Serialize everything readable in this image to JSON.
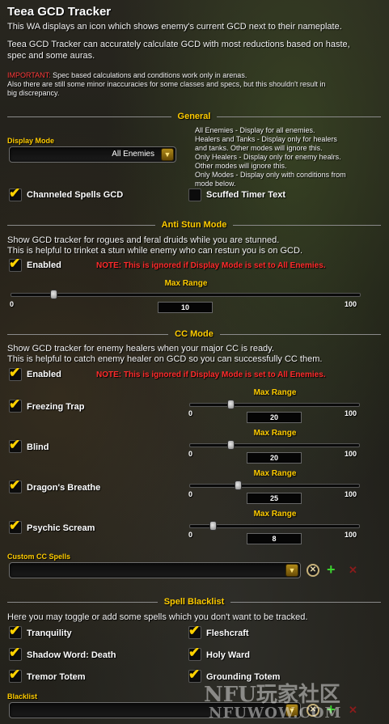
{
  "title": "Teea GCD Tracker",
  "intro": {
    "line1": "This WA displays an icon which shows enemy's current GCD next to their nameplate.",
    "line2": "Teea GCD Tracker can accurately calculate GCD with most reductions based on haste,",
    "line3": "spec and some auras.",
    "important_label": "IMPORTANT:",
    "important_text": " Spec based calculations and conditions work only in arenas.",
    "note_line2": "Also there are still some minor inaccuracies for some classes and specs, but this shouldn't result in",
    "note_line3": "big discrepancy."
  },
  "general": {
    "header": "General",
    "display_mode_label": "Display Mode",
    "display_mode_value": "All Enemies",
    "help": [
      "All Enemies - Display for all enemies.",
      "Healers and Tanks - Display only for healers",
      "and tanks. Other modes will ignore this.",
      "Only Healers - Display only for enemy healrs.",
      "Other modes will ignore this.",
      "Only Modes - Display only with conditions from",
      "mode below."
    ],
    "channeled_label": "Channeled Spells GCD",
    "scuffed_label": "Scuffed Timer Text"
  },
  "anti_stun": {
    "header": "Anti Stun Mode",
    "desc1": "Show GCD tracker for rogues and feral druids while you are stunned.",
    "desc2": "This is helpful to trinket a stun while enemy who can restun you is on GCD.",
    "enabled_label": "Enabled",
    "note": "NOTE: This is ignored if Display Mode is set to All Enemies.",
    "range_title": "Max Range",
    "min": "0",
    "max": "100",
    "value": "10"
  },
  "cc_mode": {
    "header": "CC Mode",
    "desc1": "Show GCD tracker for enemy healers when your major CC is ready.",
    "desc2": "This is helpful to catch enemy healer on GCD so you can successfully CC them.",
    "enabled_label": "Enabled",
    "note": "NOTE: This is ignored if Display Mode is set to All Enemies.",
    "spells": [
      {
        "label": "Freezing Trap",
        "range_title": "Max Range",
        "min": "0",
        "max": "100",
        "value": "20"
      },
      {
        "label": "Blind",
        "range_title": "Max Range",
        "min": "0",
        "max": "100",
        "value": "20"
      },
      {
        "label": "Dragon's Breathe",
        "range_title": "Max Range",
        "min": "0",
        "max": "100",
        "value": "25"
      },
      {
        "label": "Psychic Scream",
        "range_title": "Max Range",
        "min": "0",
        "max": "100",
        "value": "8"
      }
    ],
    "custom_label": "Custom CC Spells"
  },
  "blacklist": {
    "header": "Spell Blacklist",
    "desc": "Here you may toggle or add some spells which you don't want to be tracked.",
    "spells_left": [
      "Tranquility",
      "Shadow Word: Death",
      "Tremor Totem"
    ],
    "spells_right": [
      "Fleshcraft",
      "Holy Ward",
      "Grounding Totem"
    ],
    "list_label": "Blacklist"
  },
  "watermark": {
    "top": "NFU玩家社区",
    "bottom": "NFUWOW.COM"
  },
  "icons": [
    "chevron-down-icon",
    "check-icon",
    "remove-circle-icon",
    "plus-icon",
    "close-icon"
  ],
  "colors": {
    "accent": "#ffcc00",
    "warning": "#ff2b2b",
    "check": "#ffd100",
    "add": "#3cd12f"
  }
}
